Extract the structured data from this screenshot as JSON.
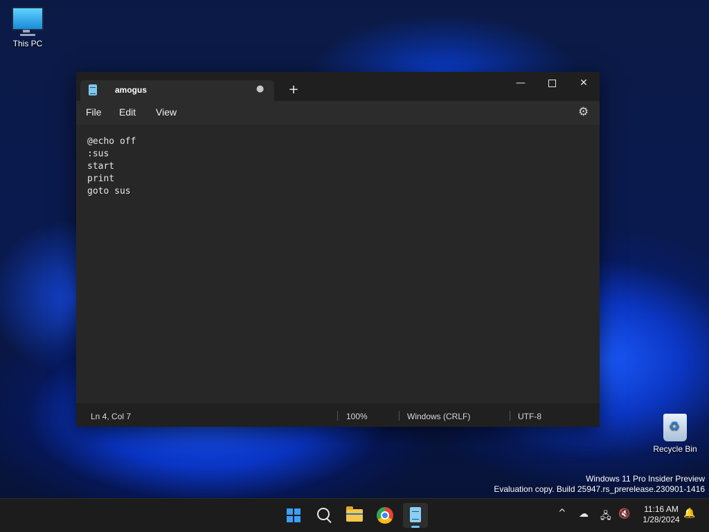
{
  "desktop": {
    "icons": [
      {
        "label": "This PC",
        "icon": "monitor-icon"
      },
      {
        "label": "Recycle Bin",
        "icon": "recycle-bin-icon"
      }
    ],
    "watermark": {
      "line1": "Windows 11 Pro Insider Preview",
      "line2": "Evaluation copy. Build 25947.rs_prerelease.230901-1416"
    }
  },
  "notepad": {
    "tab": {
      "title": "amogus",
      "unsaved_marker": "●",
      "icon": "notepad-icon"
    },
    "new_tab_label": "+",
    "window_controls": {
      "minimize": "—",
      "close": "✕"
    },
    "menu": {
      "file": "File",
      "edit": "Edit",
      "view": "View"
    },
    "settings_icon": "⚙",
    "content": "@echo off\n:sus\nstart\nprint\ngoto sus",
    "status": {
      "position": "Ln 4, Col 7",
      "zoom": "100%",
      "line_ending": "Windows (CRLF)",
      "encoding": "UTF-8"
    }
  },
  "taskbar": {
    "apps": [
      "start-icon",
      "search-icon",
      "file-explorer-icon",
      "chrome-icon",
      "notepad-icon"
    ],
    "active_app": "notepad",
    "tray": {
      "chevron": "^",
      "cloud": "☁",
      "network": "🖧",
      "volume": "🔇",
      "bell": "🔔"
    },
    "clock": {
      "time": "11:16 AM",
      "date": "1/28/2024"
    }
  },
  "colors": {
    "window_bg": "#272727",
    "titlebar_bg": "#1f1f1f",
    "taskbar_bg": "#1c1c1c",
    "accent": "#6cc7ff"
  }
}
